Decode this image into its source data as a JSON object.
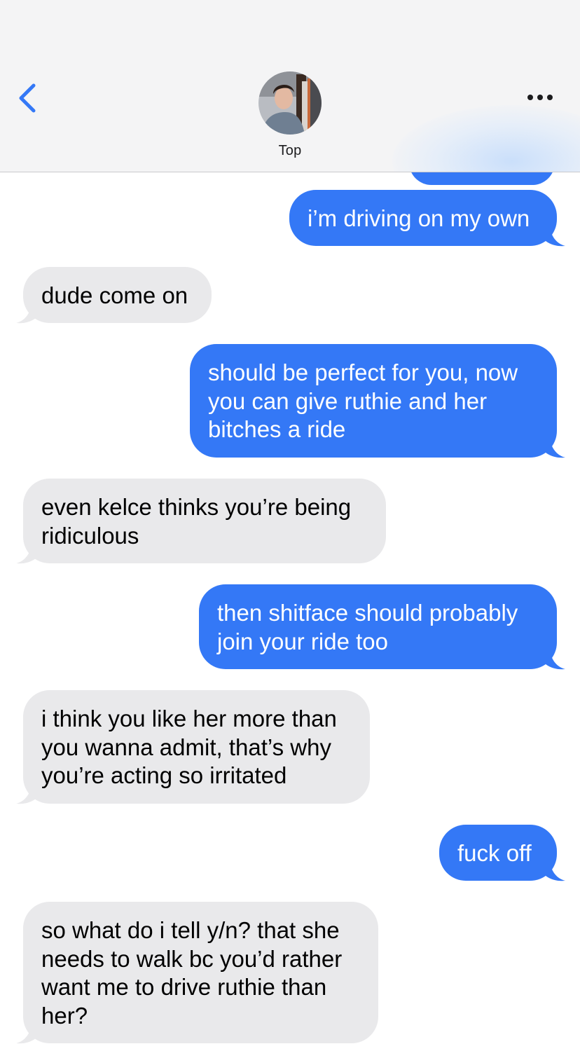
{
  "header": {
    "contact_name": "Top",
    "back_icon": "chevron-left-icon",
    "more_icon": "ellipsis-icon"
  },
  "colors": {
    "outgoing_bubble": "#3478f6",
    "incoming_bubble": "#e9e9eb",
    "accent": "#3478f6"
  },
  "messages": [
    {
      "direction": "outgoing",
      "text": "i’m driving on my own"
    },
    {
      "direction": "incoming",
      "text": "dude come on"
    },
    {
      "direction": "outgoing",
      "text": "should be perfect for you, now\nyou can give ruthie and her\nbitches a ride"
    },
    {
      "direction": "incoming",
      "text": "even kelce thinks you’re being\nridiculous"
    },
    {
      "direction": "outgoing",
      "text": "then shitface should probably\njoin your ride too"
    },
    {
      "direction": "incoming",
      "text": "i think you like her more than\nyou wanna admit, that’s why\nyou’re acting so irritated"
    },
    {
      "direction": "outgoing",
      "text": "fuck off"
    },
    {
      "direction": "incoming",
      "text": "so what do i tell y/n? that she\nneeds to walk bc you’d rather\nwant me to drive ruthie than\nher?"
    }
  ]
}
